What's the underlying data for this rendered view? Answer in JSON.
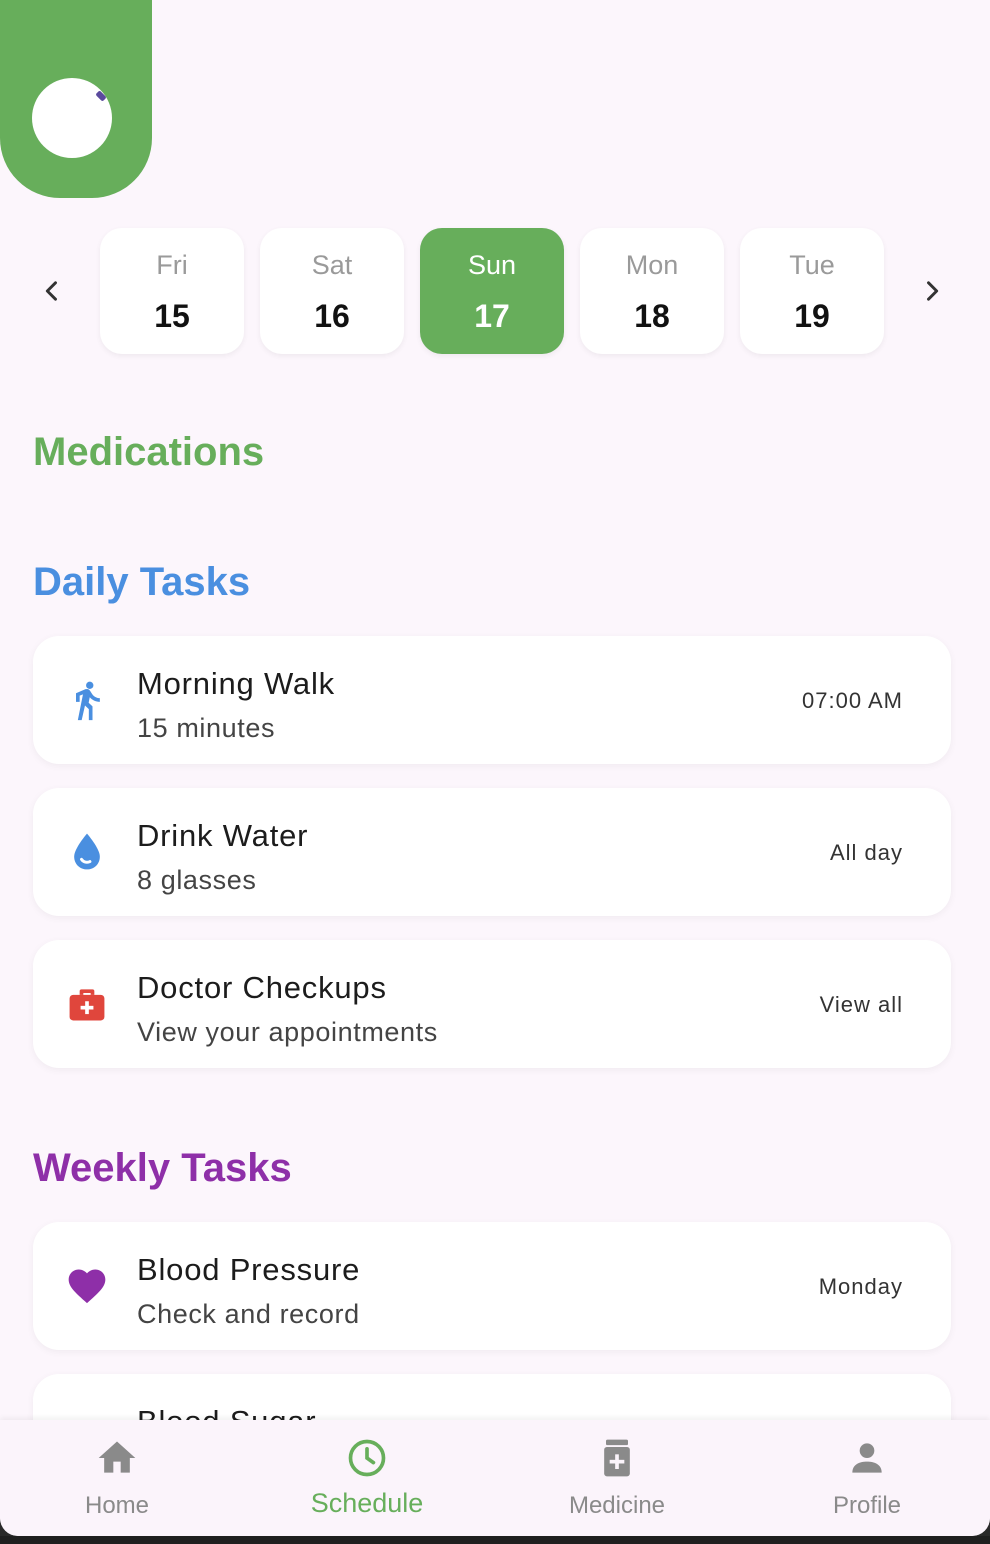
{
  "colors": {
    "accent_green": "#67ae5b",
    "daily_blue": "#4a8fe0",
    "weekly_purple": "#8e2fa8",
    "checkup_red": "#e0463c",
    "background": "#fcf6fc"
  },
  "days": [
    {
      "name": "Fri",
      "num": "15",
      "active": false
    },
    {
      "name": "Sat",
      "num": "16",
      "active": false
    },
    {
      "name": "Sun",
      "num": "17",
      "active": true
    },
    {
      "name": "Mon",
      "num": "18",
      "active": false
    },
    {
      "name": "Tue",
      "num": "19",
      "active": false
    }
  ],
  "sections": {
    "medications": "Medications",
    "daily": "Daily Tasks",
    "weekly": "Weekly Tasks"
  },
  "daily_tasks": [
    {
      "icon": "walking-icon",
      "title": "Morning Walk",
      "subtitle": "15 minutes",
      "trailing": "07:00 AM"
    },
    {
      "icon": "water-drop-icon",
      "title": "Drink Water",
      "subtitle": "8 glasses",
      "trailing": "All day"
    },
    {
      "icon": "medical-kit-icon",
      "title": "Doctor Checkups",
      "subtitle": "View your appointments",
      "trailing": "View all"
    }
  ],
  "weekly_tasks": [
    {
      "icon": "heart-icon",
      "title": "Blood Pressure",
      "subtitle": "Check and record",
      "trailing": "Monday"
    },
    {
      "icon": "",
      "title": "Blood Sugar",
      "subtitle": "",
      "trailing": ""
    }
  ],
  "nav": [
    {
      "icon": "home-icon",
      "label": "Home",
      "active": false
    },
    {
      "icon": "clock-icon",
      "label": "Schedule",
      "active": true
    },
    {
      "icon": "medicine-icon",
      "label": "Medicine",
      "active": false
    },
    {
      "icon": "person-icon",
      "label": "Profile",
      "active": false
    }
  ]
}
